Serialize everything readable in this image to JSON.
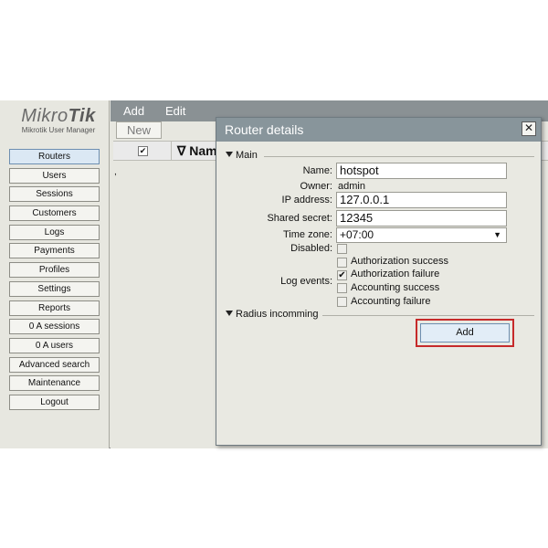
{
  "logo": {
    "brand_light": "Mikro",
    "brand_bold": "Tik",
    "subtitle": "Mikrotik User Manager"
  },
  "sidebar": {
    "items": [
      {
        "label": "Routers",
        "active": true
      },
      {
        "label": "Users"
      },
      {
        "label": "Sessions"
      },
      {
        "label": "Customers"
      },
      {
        "label": "Logs"
      },
      {
        "label": "Payments"
      },
      {
        "label": "Profiles"
      },
      {
        "label": "Settings"
      },
      {
        "label": "Reports"
      },
      {
        "label": "0 A sessions"
      },
      {
        "label": "0 A users"
      },
      {
        "label": "Advanced search"
      },
      {
        "label": "Maintenance"
      },
      {
        "label": "Logout"
      }
    ]
  },
  "menubar": {
    "add_label": "Add",
    "edit_label": "Edit"
  },
  "toolbar": {
    "new_label": "New"
  },
  "grid": {
    "name_header": "Nam",
    "check_mark": "✔",
    "sort_icon": "∇",
    "row_marker": ","
  },
  "dialog": {
    "title": "Router details",
    "close_symbol": "✕",
    "main_section": "Main",
    "fields": {
      "name_label": "Name:",
      "name_value": "hotspot",
      "owner_label": "Owner:",
      "owner_value": "admin",
      "ip_label": "IP address:",
      "ip_value": "127.0.0.1",
      "secret_label": "Shared secret:",
      "secret_value": "12345",
      "timezone_label": "Time zone:",
      "timezone_value": "+07:00",
      "disabled_label": "Disabled:"
    },
    "log_events_label": "Log events:",
    "log_events": [
      {
        "label": "Authorization success",
        "checked": false
      },
      {
        "label": "Authorization failure",
        "checked": true
      },
      {
        "label": "Accounting success",
        "checked": false
      },
      {
        "label": "Accounting failure",
        "checked": false
      }
    ],
    "radius_section": "Radius incomming",
    "add_button": "Add"
  },
  "colors": {
    "menubar": "#8a9194",
    "dialog_title": "#88959b",
    "highlight_frame": "#c62a2a",
    "background": "#e7e7e0"
  }
}
